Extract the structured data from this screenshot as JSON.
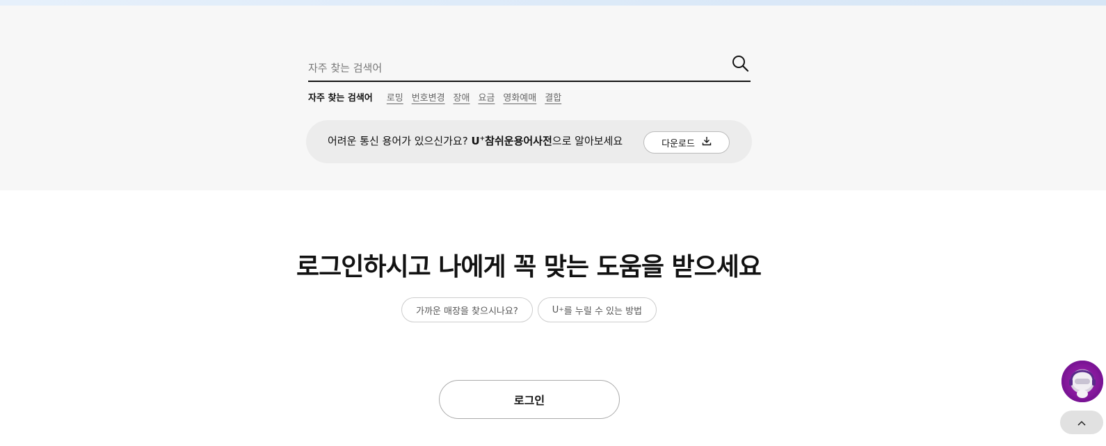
{
  "search": {
    "placeholder": "자주 찾는 검색어",
    "keywords_title": "자주 찾는 검색어",
    "keywords": [
      "로밍",
      "번호변경",
      "장애",
      "요금",
      "영화예매",
      "결합"
    ]
  },
  "dictionary_banner": {
    "text_prefix": "어려운 통신 용어가 있으신가요? ",
    "brand_u": "U",
    "brand_plus": "+",
    "brand_name": "참쉬운용어사전",
    "text_suffix": "으로 알아보세요",
    "download_label": "다운로드"
  },
  "login_section": {
    "title": "로그인하시고 나에게 꼭 맞는 도움을 받으세요",
    "chip_store": "가까운 매장을 찾으시나요?",
    "chip_benefit_u": "U",
    "chip_benefit_plus": "+",
    "chip_benefit_rest": "를 누릴 수 있는 방법",
    "login_label": "로그인"
  },
  "floating": {
    "chatbot_icon": "chatbot-robot-icon",
    "top_icon": "chevron-up-icon"
  },
  "colors": {
    "search_bg": "#f7f7f7",
    "banner_bg": "#ececec",
    "chatbot_accent": "#8a1aa0"
  }
}
